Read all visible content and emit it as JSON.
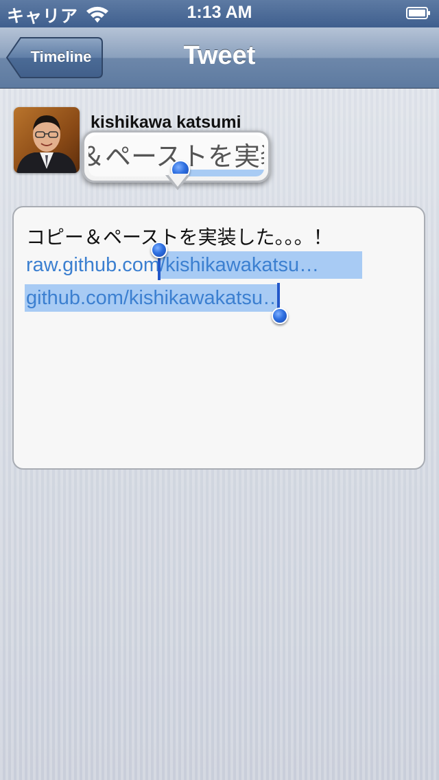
{
  "status_bar": {
    "carrier": "キャリア",
    "time": "1:13 AM"
  },
  "nav": {
    "back_label": "Timeline",
    "title": "Tweet"
  },
  "profile": {
    "username": "kishikawa katsumi"
  },
  "tweet": {
    "line1": "コピー＆ペーストを実装した。。。！",
    "line2_before": "raw.github.co",
    "line2_selected": "m/kishikawakatsu…",
    "line3_selected": "github.com/kishikawakats",
    "line3_after": "u…"
  },
  "magnifier": {
    "text": "＆ペーストを実装"
  },
  "colors": {
    "link": "#3b7fd0",
    "selection": "#a8cbf4",
    "handle": "#2e6fe0",
    "nav_bar": "#6d87aa"
  }
}
